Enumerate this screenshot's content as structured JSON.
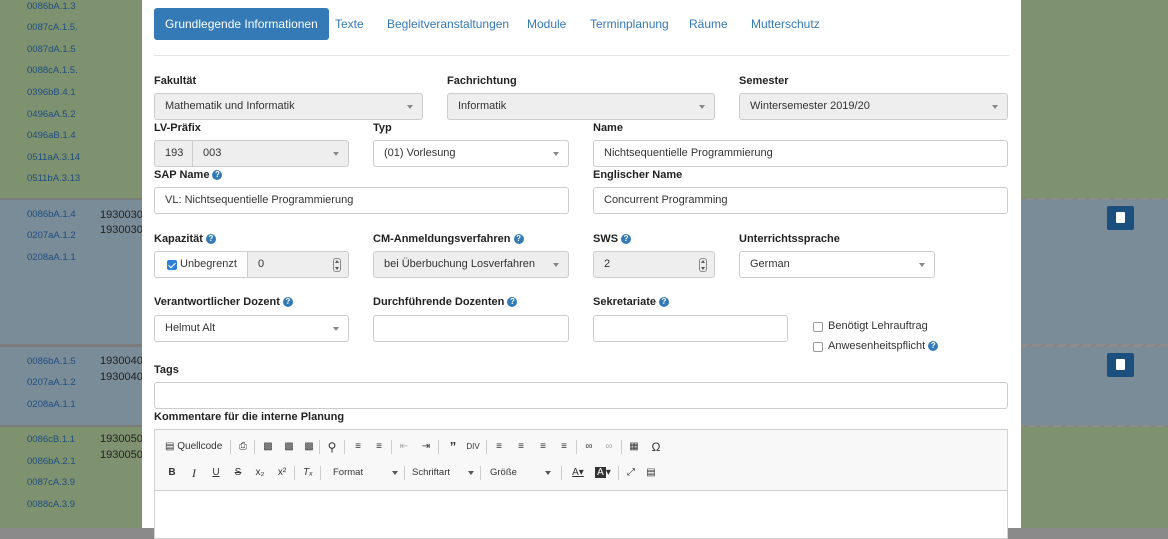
{
  "background": {
    "rows_top": [
      "0086bA.1.3",
      "0087cA.1.5.",
      "0087dA.1.5",
      "0088cA.1.5.",
      "0396bB.4.1",
      "0496aA.5.2",
      "0496aB.1.4",
      "0511aA.3.14",
      "0511bA.3.13"
    ],
    "rows_mid": [
      "0086bA.1.4",
      "0207aA.1.2",
      "0208aA.1.1"
    ],
    "nums_mid": [
      "1930030",
      "1930030"
    ],
    "rows_mid2": [
      "0086bA.1.5",
      "0207aA.1.2",
      "0208aA.1.1"
    ],
    "nums_mid2": [
      "1930040",
      "1930040"
    ],
    "rows_bottom": [
      "0086cB.1.1",
      "0086bA.2.1",
      "0087cA.3.9",
      "0088cA.3.9"
    ],
    "nums_bottom": [
      "1930050",
      "1930050"
    ]
  },
  "tabs": [
    "Grundlegende Informationen",
    "Texte",
    "Begleitveranstaltungen",
    "Module",
    "Terminplanung",
    "Räume",
    "Mutterschutz"
  ],
  "form": {
    "fakultaet": {
      "label": "Fakultät",
      "value": "Mathematik und Informatik"
    },
    "fachrichtung": {
      "label": "Fachrichtung",
      "value": "Informatik"
    },
    "semester": {
      "label": "Semester",
      "value": "Wintersemester 2019/20"
    },
    "lv_praefix": {
      "label": "LV-Präfix",
      "prefix": "193",
      "value": "003"
    },
    "typ": {
      "label": "Typ",
      "value": "(01) Vorlesung"
    },
    "name": {
      "label": "Name",
      "value": "Nichtsequentielle Programmierung"
    },
    "sap_name": {
      "label": "SAP Name",
      "value": "VL: Nichtsequentielle Programmierung"
    },
    "englischer_name": {
      "label": "Englischer Name",
      "value": "Concurrent Programming"
    },
    "kapazitaet": {
      "label": "Kapazität",
      "checkbox_label": "Unbegrenzt",
      "checked": true,
      "value": "0"
    },
    "cm_verfahren": {
      "label": "CM-Anmeldungsverfahren",
      "value": "bei Überbuchung Losverfahren"
    },
    "sws": {
      "label": "SWS",
      "value": "2"
    },
    "unterrichtssprache": {
      "label": "Unterrichtssprache",
      "value": "German"
    },
    "dozent": {
      "label": "Verantwortlicher Dozent",
      "value": "Helmut Alt"
    },
    "durchfuehrende": {
      "label": "Durchführende Dozenten",
      "value": ""
    },
    "sekretariate": {
      "label": "Sekretariate",
      "value": ""
    },
    "lehrauftrag": {
      "label": "Benötigt Lehrauftrag",
      "checked": false
    },
    "anwesenheit": {
      "label": "Anwesenheitspflicht",
      "checked": false
    },
    "tags": {
      "label": "Tags",
      "value": ""
    },
    "kommentare": {
      "label": "Kommentare für die interne Planung"
    }
  },
  "editor": {
    "source_label": "Quellcode",
    "format_label": "Format",
    "font_label": "Schriftart",
    "size_label": "Größe"
  },
  "colors": {
    "primary": "#337ab7"
  }
}
